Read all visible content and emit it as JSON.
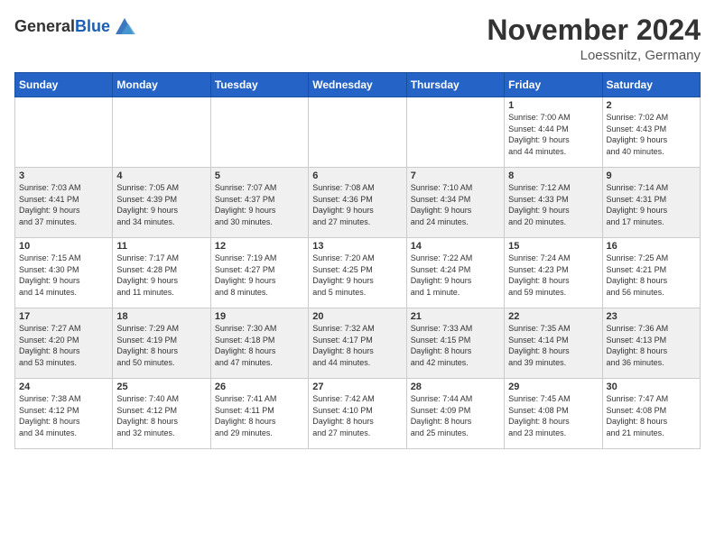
{
  "header": {
    "logo_general": "General",
    "logo_blue": "Blue",
    "month_title": "November 2024",
    "location": "Loessnitz, Germany"
  },
  "weekdays": [
    "Sunday",
    "Monday",
    "Tuesday",
    "Wednesday",
    "Thursday",
    "Friday",
    "Saturday"
  ],
  "weeks": [
    [
      {
        "day": "",
        "info": ""
      },
      {
        "day": "",
        "info": ""
      },
      {
        "day": "",
        "info": ""
      },
      {
        "day": "",
        "info": ""
      },
      {
        "day": "",
        "info": ""
      },
      {
        "day": "1",
        "info": "Sunrise: 7:00 AM\nSunset: 4:44 PM\nDaylight: 9 hours\nand 44 minutes."
      },
      {
        "day": "2",
        "info": "Sunrise: 7:02 AM\nSunset: 4:43 PM\nDaylight: 9 hours\nand 40 minutes."
      }
    ],
    [
      {
        "day": "3",
        "info": "Sunrise: 7:03 AM\nSunset: 4:41 PM\nDaylight: 9 hours\nand 37 minutes."
      },
      {
        "day": "4",
        "info": "Sunrise: 7:05 AM\nSunset: 4:39 PM\nDaylight: 9 hours\nand 34 minutes."
      },
      {
        "day": "5",
        "info": "Sunrise: 7:07 AM\nSunset: 4:37 PM\nDaylight: 9 hours\nand 30 minutes."
      },
      {
        "day": "6",
        "info": "Sunrise: 7:08 AM\nSunset: 4:36 PM\nDaylight: 9 hours\nand 27 minutes."
      },
      {
        "day": "7",
        "info": "Sunrise: 7:10 AM\nSunset: 4:34 PM\nDaylight: 9 hours\nand 24 minutes."
      },
      {
        "day": "8",
        "info": "Sunrise: 7:12 AM\nSunset: 4:33 PM\nDaylight: 9 hours\nand 20 minutes."
      },
      {
        "day": "9",
        "info": "Sunrise: 7:14 AM\nSunset: 4:31 PM\nDaylight: 9 hours\nand 17 minutes."
      }
    ],
    [
      {
        "day": "10",
        "info": "Sunrise: 7:15 AM\nSunset: 4:30 PM\nDaylight: 9 hours\nand 14 minutes."
      },
      {
        "day": "11",
        "info": "Sunrise: 7:17 AM\nSunset: 4:28 PM\nDaylight: 9 hours\nand 11 minutes."
      },
      {
        "day": "12",
        "info": "Sunrise: 7:19 AM\nSunset: 4:27 PM\nDaylight: 9 hours\nand 8 minutes."
      },
      {
        "day": "13",
        "info": "Sunrise: 7:20 AM\nSunset: 4:25 PM\nDaylight: 9 hours\nand 5 minutes."
      },
      {
        "day": "14",
        "info": "Sunrise: 7:22 AM\nSunset: 4:24 PM\nDaylight: 9 hours\nand 1 minute."
      },
      {
        "day": "15",
        "info": "Sunrise: 7:24 AM\nSunset: 4:23 PM\nDaylight: 8 hours\nand 59 minutes."
      },
      {
        "day": "16",
        "info": "Sunrise: 7:25 AM\nSunset: 4:21 PM\nDaylight: 8 hours\nand 56 minutes."
      }
    ],
    [
      {
        "day": "17",
        "info": "Sunrise: 7:27 AM\nSunset: 4:20 PM\nDaylight: 8 hours\nand 53 minutes."
      },
      {
        "day": "18",
        "info": "Sunrise: 7:29 AM\nSunset: 4:19 PM\nDaylight: 8 hours\nand 50 minutes."
      },
      {
        "day": "19",
        "info": "Sunrise: 7:30 AM\nSunset: 4:18 PM\nDaylight: 8 hours\nand 47 minutes."
      },
      {
        "day": "20",
        "info": "Sunrise: 7:32 AM\nSunset: 4:17 PM\nDaylight: 8 hours\nand 44 minutes."
      },
      {
        "day": "21",
        "info": "Sunrise: 7:33 AM\nSunset: 4:15 PM\nDaylight: 8 hours\nand 42 minutes."
      },
      {
        "day": "22",
        "info": "Sunrise: 7:35 AM\nSunset: 4:14 PM\nDaylight: 8 hours\nand 39 minutes."
      },
      {
        "day": "23",
        "info": "Sunrise: 7:36 AM\nSunset: 4:13 PM\nDaylight: 8 hours\nand 36 minutes."
      }
    ],
    [
      {
        "day": "24",
        "info": "Sunrise: 7:38 AM\nSunset: 4:12 PM\nDaylight: 8 hours\nand 34 minutes."
      },
      {
        "day": "25",
        "info": "Sunrise: 7:40 AM\nSunset: 4:12 PM\nDaylight: 8 hours\nand 32 minutes."
      },
      {
        "day": "26",
        "info": "Sunrise: 7:41 AM\nSunset: 4:11 PM\nDaylight: 8 hours\nand 29 minutes."
      },
      {
        "day": "27",
        "info": "Sunrise: 7:42 AM\nSunset: 4:10 PM\nDaylight: 8 hours\nand 27 minutes."
      },
      {
        "day": "28",
        "info": "Sunrise: 7:44 AM\nSunset: 4:09 PM\nDaylight: 8 hours\nand 25 minutes."
      },
      {
        "day": "29",
        "info": "Sunrise: 7:45 AM\nSunset: 4:08 PM\nDaylight: 8 hours\nand 23 minutes."
      },
      {
        "day": "30",
        "info": "Sunrise: 7:47 AM\nSunset: 4:08 PM\nDaylight: 8 hours\nand 21 minutes."
      }
    ]
  ]
}
